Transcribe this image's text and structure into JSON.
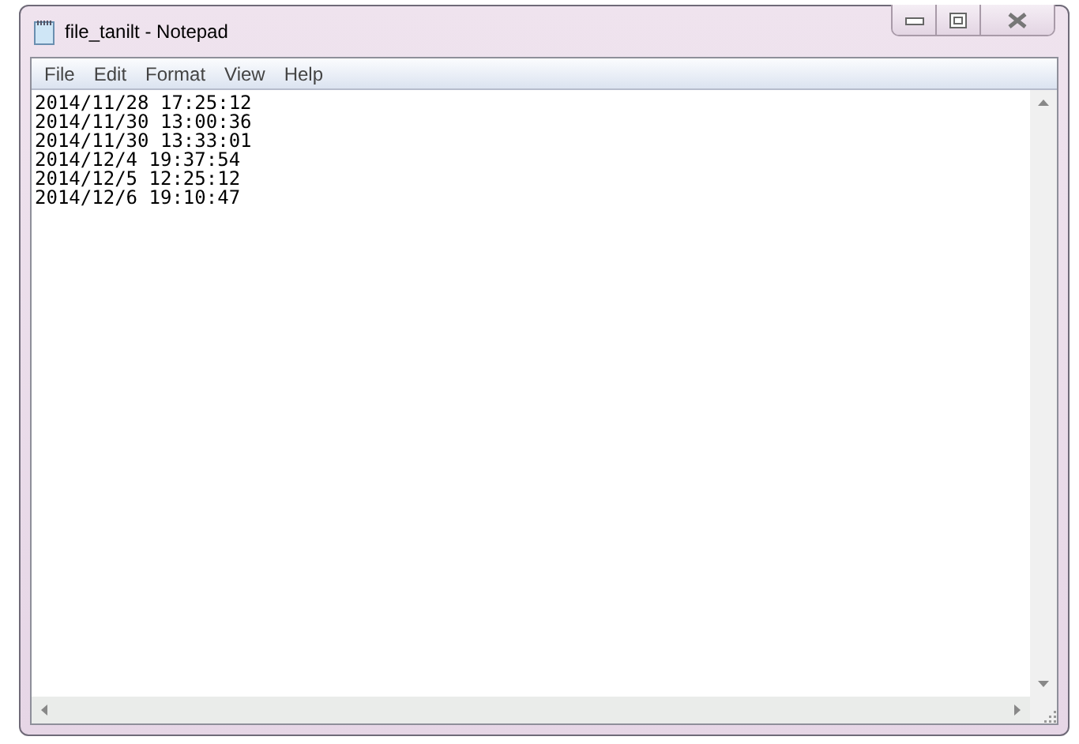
{
  "window": {
    "title": "file_tanilt - Notepad"
  },
  "menu": [
    "File",
    "Edit",
    "Format",
    "View",
    "Help"
  ],
  "lines": [
    "2014/11/28 17:25:12",
    "2014/11/30 13:00:36",
    "2014/11/30 13:33:01",
    "2014/12/4 19:37:54",
    "2014/12/5 12:25:12",
    "2014/12/6 19:10:47"
  ]
}
